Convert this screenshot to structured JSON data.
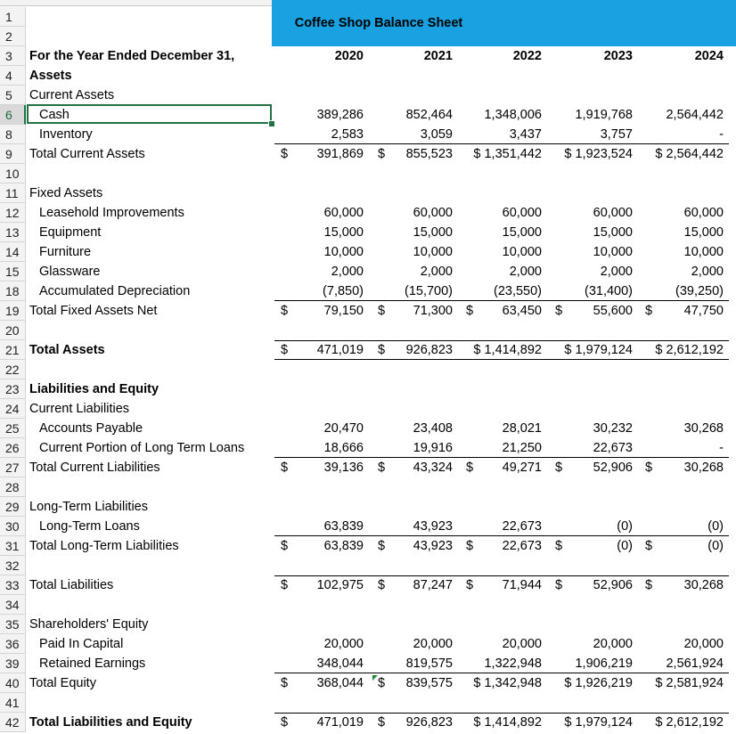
{
  "title": "Coffee Shop Balance Sheet",
  "header_label": "For the Year Ended December 31,",
  "years": [
    "2020",
    "2021",
    "2022",
    "2023",
    "2024"
  ],
  "row_numbers": [
    "1",
    "2",
    "3",
    "4",
    "5",
    "6",
    "8",
    "9",
    "10",
    "11",
    "12",
    "13",
    "14",
    "15",
    "18",
    "19",
    "20",
    "21",
    "22",
    "23",
    "24",
    "25",
    "26",
    "27",
    "28",
    "29",
    "30",
    "31",
    "32",
    "33",
    "34",
    "35",
    "36",
    "39",
    "40",
    "41",
    "42"
  ],
  "rows": {
    "assets": "Assets",
    "current_assets": "Current Assets",
    "cash": {
      "label": "Cash",
      "values": [
        "389,286",
        "852,464",
        "1,348,006",
        "1,919,768",
        "2,564,442"
      ]
    },
    "inventory": {
      "label": "Inventory",
      "values": [
        "2,583",
        "3,059",
        "3,437",
        "3,757",
        "-"
      ]
    },
    "total_current_assets": {
      "label": "Total Current Assets",
      "values": [
        "391,869",
        "855,523",
        "$ 1,351,442",
        "$ 1,923,524",
        "$ 2,564,442"
      ]
    },
    "fixed_assets": "Fixed Assets",
    "leasehold": {
      "label": "Leasehold Improvements",
      "values": [
        "60,000",
        "60,000",
        "60,000",
        "60,000",
        "60,000"
      ]
    },
    "equipment": {
      "label": "Equipment",
      "values": [
        "15,000",
        "15,000",
        "15,000",
        "15,000",
        "15,000"
      ]
    },
    "furniture": {
      "label": "Furniture",
      "values": [
        "10,000",
        "10,000",
        "10,000",
        "10,000",
        "10,000"
      ]
    },
    "glassware": {
      "label": "Glassware",
      "values": [
        "2,000",
        "2,000",
        "2,000",
        "2,000",
        "2,000"
      ]
    },
    "accum_dep": {
      "label": "Accumulated Depreciation",
      "values": [
        "(7,850)",
        "(15,700)",
        "(23,550)",
        "(31,400)",
        "(39,250)"
      ]
    },
    "total_fixed": {
      "label": "Total Fixed Assets Net",
      "values": [
        "79,150",
        "71,300",
        "63,450",
        "55,600",
        "47,750"
      ]
    },
    "total_assets": {
      "label": "Total Assets",
      "values": [
        "471,019",
        "926,823",
        "$ 1,414,892",
        "$ 1,979,124",
        "$ 2,612,192"
      ]
    },
    "liab_equity": "Liabilities and Equity",
    "current_liab": "Current Liabilities",
    "accounts_payable": {
      "label": "Accounts Payable",
      "values": [
        "20,470",
        "23,408",
        "28,021",
        "30,232",
        "30,268"
      ]
    },
    "current_ltl": {
      "label": "Current Portion of Long Term Loans",
      "values": [
        "18,666",
        "19,916",
        "21,250",
        "22,673",
        "-"
      ]
    },
    "total_current_liab": {
      "label": "Total Current Liabilities",
      "values": [
        "39,136",
        "43,324",
        "49,271",
        "52,906",
        "30,268"
      ]
    },
    "long_term_liab": "Long-Term Liabilities",
    "long_term_loans": {
      "label": "Long-Term Loans",
      "values": [
        "63,839",
        "43,923",
        "22,673",
        "(0)",
        "(0)"
      ]
    },
    "total_lt_liab": {
      "label": "Total Long-Term Liabilities",
      "values": [
        "63,839",
        "43,923",
        "22,673",
        "(0)",
        "(0)"
      ]
    },
    "total_liab": {
      "label": "Total Liabilities",
      "values": [
        "102,975",
        "87,247",
        "71,944",
        "52,906",
        "30,268"
      ]
    },
    "shareholders_equity": "Shareholders' Equity",
    "paid_in": {
      "label": "Paid In Capital",
      "values": [
        "20,000",
        "20,000",
        "20,000",
        "20,000",
        "20,000"
      ]
    },
    "retained": {
      "label": "Retained Earnings",
      "values": [
        "348,044",
        "819,575",
        "1,322,948",
        "1,906,219",
        "2,561,924"
      ]
    },
    "total_equity": {
      "label": "Total Equity",
      "values": [
        "368,044",
        "839,575",
        "$ 1,342,948",
        "$ 1,926,219",
        "$ 2,581,924"
      ]
    },
    "total_le": {
      "label": "Total Liabilities and Equity",
      "values": [
        "471,019",
        "926,823",
        "$ 1,414,892",
        "$ 1,979,124",
        "$ 2,612,192"
      ]
    }
  },
  "dollar": "$",
  "colors": {
    "header_band": "#1aa1e2",
    "selection": "#217346"
  }
}
